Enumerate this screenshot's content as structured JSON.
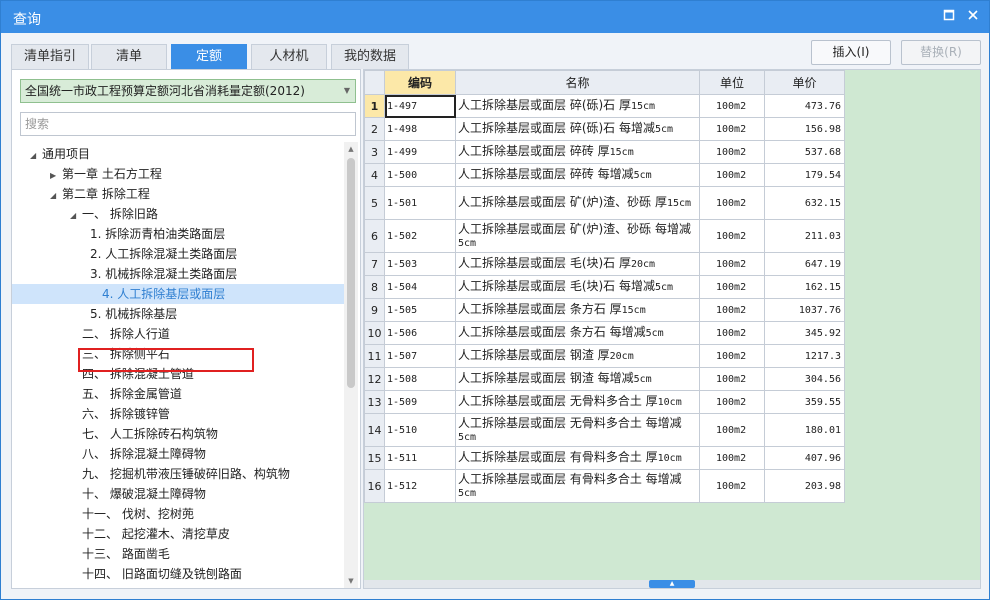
{
  "window": {
    "title": "查询"
  },
  "tabs": [
    {
      "label": "清单指引"
    },
    {
      "label": "清单"
    },
    {
      "label": "定额",
      "active": true
    },
    {
      "label": "人材机"
    },
    {
      "label": "我的数据"
    }
  ],
  "actions": {
    "insert": "插入(I)",
    "replace": "替换(R)"
  },
  "library": {
    "selected": "全国统一市政工程预算定额河北省消耗量定额(2012)"
  },
  "search": {
    "placeholder": "搜索",
    "value": ""
  },
  "tree": [
    {
      "text": "通用项目",
      "level": 0,
      "toggle": "open"
    },
    {
      "text": "第一章 土石方工程",
      "level": 1,
      "toggle": "closed"
    },
    {
      "text": "第二章 拆除工程",
      "level": 1,
      "toggle": "open"
    },
    {
      "text": "一、 拆除旧路",
      "level": 2,
      "toggle": "open"
    },
    {
      "text": "1. 拆除沥青柏油类路面层",
      "level": 3,
      "toggle": ""
    },
    {
      "text": "2. 人工拆除混凝土类路面层",
      "level": 3,
      "toggle": ""
    },
    {
      "text": "3. 机械拆除混凝土类路面层",
      "level": 3,
      "toggle": ""
    },
    {
      "text": "4. 人工拆除基层或面层",
      "level": 3,
      "toggle": "",
      "selected": true
    },
    {
      "text": "5. 机械拆除基层",
      "level": 3,
      "toggle": ""
    },
    {
      "text": "二、 拆除人行道",
      "level": 2,
      "toggle": ""
    },
    {
      "text": "三、 拆除侧平石",
      "level": 2,
      "toggle": ""
    },
    {
      "text": "四、 拆除混凝土管道",
      "level": 2,
      "toggle": ""
    },
    {
      "text": "五、 拆除金属管道",
      "level": 2,
      "toggle": ""
    },
    {
      "text": "六、 拆除镀锌管",
      "level": 2,
      "toggle": ""
    },
    {
      "text": "七、 人工拆除砖石构筑物",
      "level": 2,
      "toggle": ""
    },
    {
      "text": "八、 拆除混凝土障碍物",
      "level": 2,
      "toggle": ""
    },
    {
      "text": "九、 挖掘机带液压锤破碎旧路、构筑物",
      "level": 2,
      "toggle": ""
    },
    {
      "text": "十、 爆破混凝土障碍物",
      "level": 2,
      "toggle": ""
    },
    {
      "text": "十一、 伐树、挖树蔸",
      "level": 2,
      "toggle": ""
    },
    {
      "text": "十二、 起挖灌木、清挖草皮",
      "level": 2,
      "toggle": ""
    },
    {
      "text": "十三、 路面凿毛",
      "level": 2,
      "toggle": ""
    },
    {
      "text": "十四、 旧路面切缝及铣刨路面",
      "level": 2,
      "toggle": ""
    }
  ],
  "table": {
    "headers": {
      "code": "编码",
      "name": "名称",
      "unit": "单位",
      "price": "单价"
    },
    "rows": [
      {
        "no": "1",
        "code": "1-497",
        "name": "人工拆除基层或面层 碎(砾)石 厚",
        "name_suffix": "15cm",
        "name_wrap": false,
        "unit": "100m2",
        "price": "473.76"
      },
      {
        "no": "2",
        "code": "1-498",
        "name": "人工拆除基层或面层 碎(砾)石 每增减",
        "name_suffix": "5cm",
        "name_wrap": false,
        "unit": "100m2",
        "price": "156.98"
      },
      {
        "no": "3",
        "code": "1-499",
        "name": "人工拆除基层或面层 碎砖 厚",
        "name_suffix": "15cm",
        "name_wrap": false,
        "unit": "100m2",
        "price": "537.68"
      },
      {
        "no": "4",
        "code": "1-500",
        "name": "人工拆除基层或面层 碎砖 每增减",
        "name_suffix": "5cm",
        "name_wrap": false,
        "unit": "100m2",
        "price": "179.54"
      },
      {
        "no": "5",
        "code": "1-501",
        "name": "人工拆除基层或面层 矿(炉)渣、砂砾 厚",
        "name_suffix": "15cm",
        "name_wrap": true,
        "unit": "100m2",
        "price": "632.15"
      },
      {
        "no": "6",
        "code": "1-502",
        "name": "人工拆除基层或面层 矿(炉)渣、砂砾 每增减",
        "name_suffix": "5cm",
        "name_wrap": true,
        "unit": "100m2",
        "price": "211.03"
      },
      {
        "no": "7",
        "code": "1-503",
        "name": "人工拆除基层或面层 毛(块)石 厚",
        "name_suffix": "20cm",
        "name_wrap": false,
        "unit": "100m2",
        "price": "647.19"
      },
      {
        "no": "8",
        "code": "1-504",
        "name": "人工拆除基层或面层 毛(块)石 每增减",
        "name_suffix": "5cm",
        "name_wrap": false,
        "unit": "100m2",
        "price": "162.15"
      },
      {
        "no": "9",
        "code": "1-505",
        "name": "人工拆除基层或面层 条方石 厚",
        "name_suffix": "15cm",
        "name_wrap": false,
        "unit": "100m2",
        "price": "1037.76"
      },
      {
        "no": "10",
        "code": "1-506",
        "name": "人工拆除基层或面层 条方石 每增减",
        "name_suffix": "5cm",
        "name_wrap": false,
        "unit": "100m2",
        "price": "345.92"
      },
      {
        "no": "11",
        "code": "1-507",
        "name": "人工拆除基层或面层 钢渣 厚",
        "name_suffix": "20cm",
        "name_wrap": false,
        "unit": "100m2",
        "price": "1217.3"
      },
      {
        "no": "12",
        "code": "1-508",
        "name": "人工拆除基层或面层 钢渣 每增减",
        "name_suffix": "5cm",
        "name_wrap": false,
        "unit": "100m2",
        "price": "304.56"
      },
      {
        "no": "13",
        "code": "1-509",
        "name": "人工拆除基层或面层 无骨料多合土 厚",
        "name_suffix": "10cm",
        "name_wrap": false,
        "unit": "100m2",
        "price": "359.55"
      },
      {
        "no": "14",
        "code": "1-510",
        "name": "人工拆除基层或面层 无骨料多合土 每增减",
        "name_suffix": "5cm",
        "name_wrap": true,
        "unit": "100m2",
        "price": "180.01"
      },
      {
        "no": "15",
        "code": "1-511",
        "name": "人工拆除基层或面层 有骨料多合土 厚",
        "name_suffix": "10cm",
        "name_wrap": false,
        "unit": "100m2",
        "price": "407.96"
      },
      {
        "no": "16",
        "code": "1-512",
        "name": "人工拆除基层或面层 有骨料多合土 每增减",
        "name_suffix": "5cm",
        "name_wrap": true,
        "unit": "100m2",
        "price": "203.98"
      }
    ]
  },
  "colors": {
    "accent": "#3a8ee6",
    "selection": "#cfe4fb",
    "header_highlight": "#fce8a8",
    "empty_area": "#cfe8d2",
    "annotation": "#e02020"
  }
}
